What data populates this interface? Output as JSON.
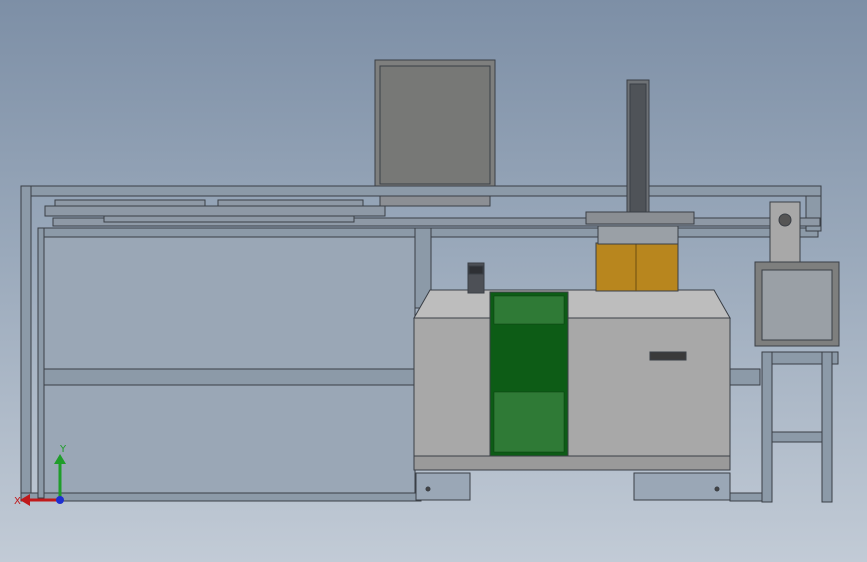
{
  "viewport": {
    "background_top": "#7d8fa6",
    "background_bottom": "#c2cbd6"
  },
  "model": {
    "frame_color": "#8c9aa8",
    "frame_edge": "#3a3f46",
    "cabinet_color": "#a8a8a8",
    "panel_color": "#0d5c16",
    "drum_color": "#b8861e",
    "monitor_color": "#7e7f7e"
  },
  "triad": {
    "x_label": "X",
    "y_label": "Y",
    "x_color": "#c0191b",
    "y_color": "#1f9d2a",
    "z_color": "#1e2fd0"
  }
}
